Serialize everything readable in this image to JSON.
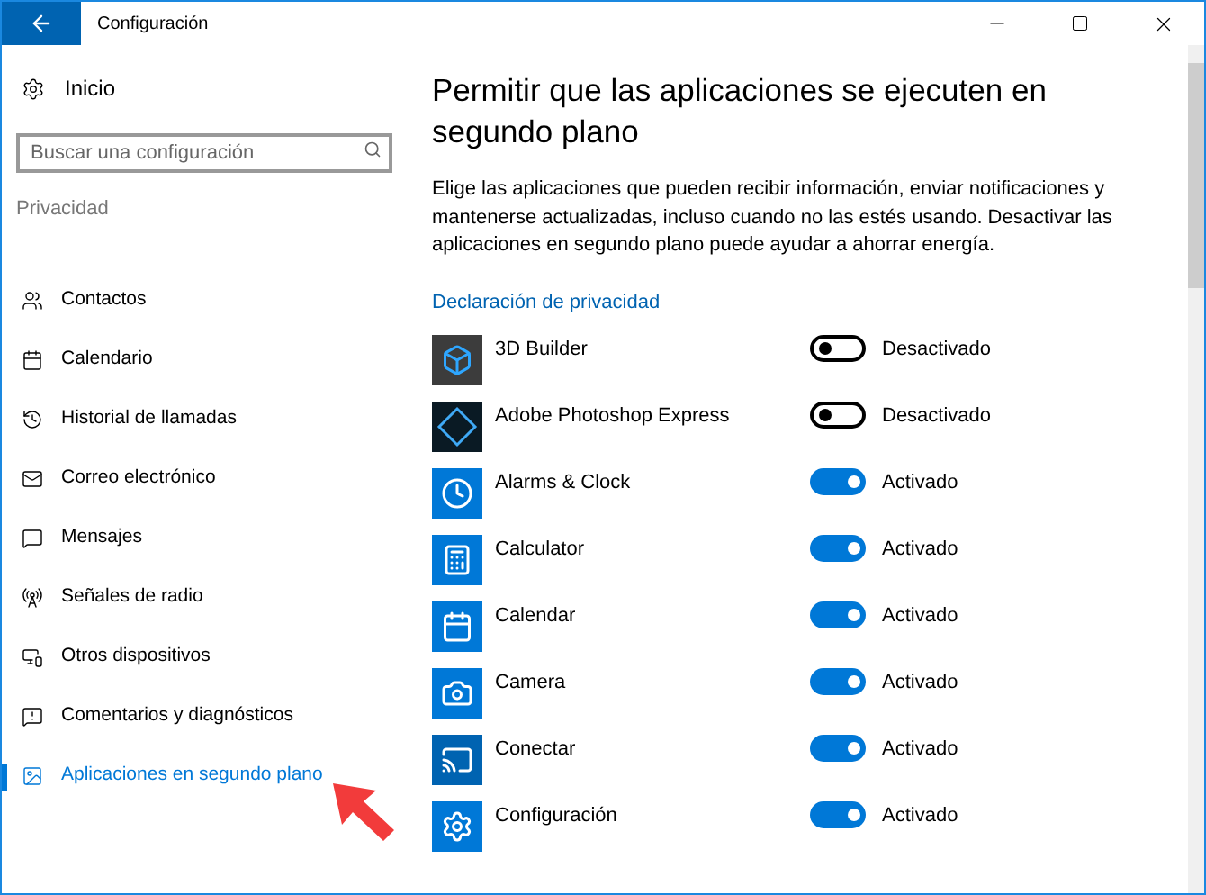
{
  "window": {
    "title": "Configuración"
  },
  "sidebar": {
    "home": "Inicio",
    "search": {
      "placeholder": "Buscar una configuración"
    },
    "section": "Privacidad",
    "items": [
      {
        "label": "Contactos",
        "selected": false
      },
      {
        "label": "Calendario",
        "selected": false
      },
      {
        "label": "Historial de llamadas",
        "selected": false
      },
      {
        "label": "Correo electrónico",
        "selected": false
      },
      {
        "label": "Mensajes",
        "selected": false
      },
      {
        "label": "Señales de radio",
        "selected": false
      },
      {
        "label": "Otros dispositivos",
        "selected": false
      },
      {
        "label": "Comentarios y diagnósticos",
        "selected": false
      },
      {
        "label": "Aplicaciones en segundo plano",
        "selected": true
      }
    ]
  },
  "content": {
    "heading": "Permitir que las aplicaciones se ejecuten en segundo plano",
    "description": "Elige las aplicaciones que pueden recibir información, enviar notificaciones y mantenerse actualizadas, incluso cuando no las estés usando. Desactivar las aplicaciones en segundo plano puede ayudar a ahorrar energía.",
    "link": "Declaración de privacidad",
    "apps": [
      {
        "name": "3D Builder",
        "color": "#3c3c3c",
        "on": false,
        "status": "Desactivado"
      },
      {
        "name": "Adobe Photoshop Express",
        "color": "#0a1a24",
        "on": false,
        "status": "Desactivado"
      },
      {
        "name": "Alarms & Clock",
        "color": "#0078d7",
        "on": true,
        "status": "Activado"
      },
      {
        "name": "Calculator",
        "color": "#0078d7",
        "on": true,
        "status": "Activado"
      },
      {
        "name": "Calendar",
        "color": "#0078d7",
        "on": true,
        "status": "Activado"
      },
      {
        "name": "Camera",
        "color": "#0078d7",
        "on": true,
        "status": "Activado"
      },
      {
        "name": "Conectar",
        "color": "#0063b1",
        "on": true,
        "status": "Activado"
      },
      {
        "name": "Configuración",
        "color": "#0078d7",
        "on": true,
        "status": "Activado"
      }
    ]
  }
}
